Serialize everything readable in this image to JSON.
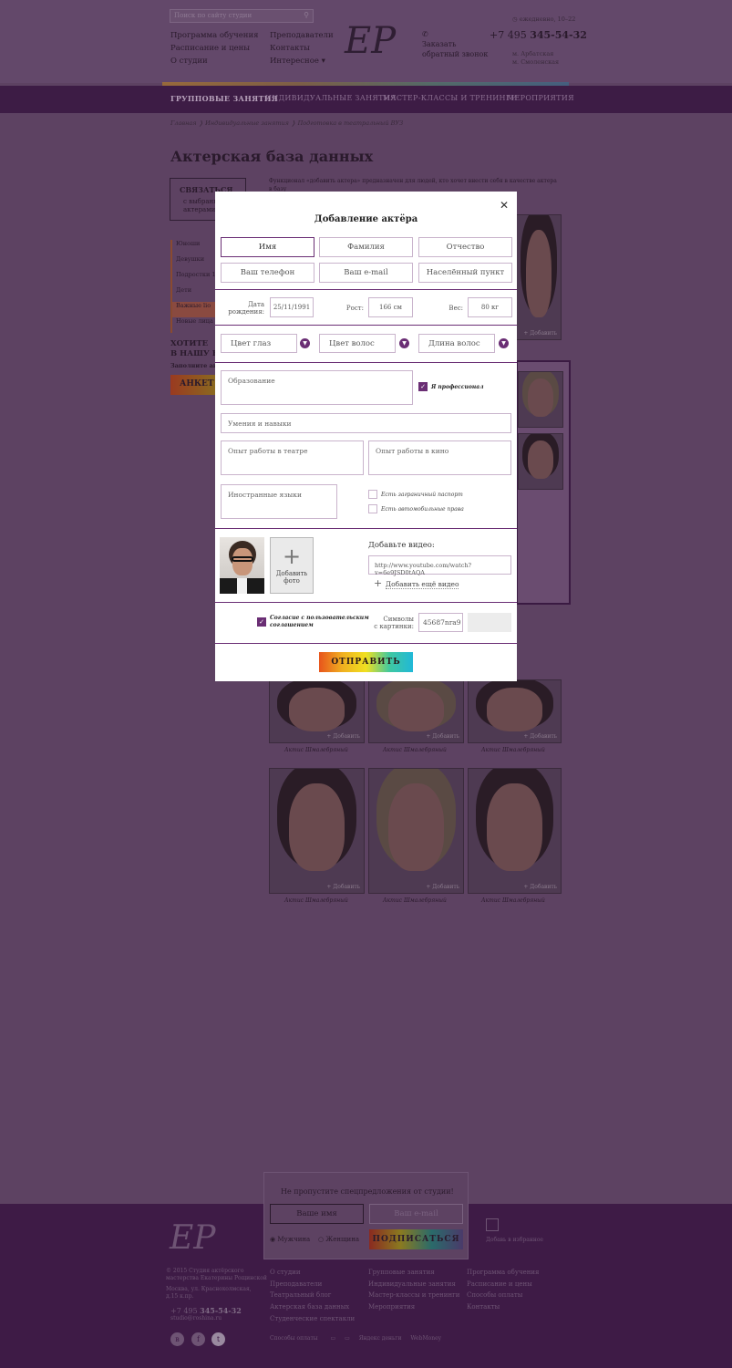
{
  "header": {
    "search_placeholder": "Поиск по сайту студии",
    "links_col1": [
      "Программа обучения",
      "Расписание и цены",
      "О студии"
    ],
    "links_col2": [
      "Преподаватели",
      "Контакты",
      "Интересное"
    ],
    "logo": "EP",
    "callback": [
      "Заказать",
      "обратный звонок"
    ],
    "worktime": "ежедневно, 10–22",
    "phone_prefix": "+7 495",
    "phone_number": "345-54-32",
    "metro": [
      "м. Арбатская",
      "м. Смоленская"
    ]
  },
  "nav": [
    "ГРУППОВЫЕ ЗАНЯТИЯ",
    "ИНДИВИДУАЛЬНЫЕ ЗАНЯТИЯ",
    "МАСТЕР-КЛАССЫ И ТРЕНИНГИ",
    "МЕРОПРИЯТИЯ"
  ],
  "breadcrumb": [
    "Главная",
    "Индивидуальные занятия",
    "Подготовка в театральный ВУЗ"
  ],
  "page_title": "Актерская база данных",
  "contact_box": {
    "title": "СВЯЗАТЬСЯ",
    "sub": [
      "с выбранными",
      "актерами"
    ]
  },
  "intro_text": "Функционал «добавить актера» предназначен для людей, кто хочет внести себя в качестве актера в базу",
  "filters": [
    "Юноши",
    "Девушки",
    "Подростки 15+",
    "Дети",
    "Важные lio",
    "Новые лица"
  ],
  "want": [
    "ХОТИТЕ",
    "В НАШУ Б"
  ],
  "want_sub": "Заполните анкет",
  "anket_btn": "АНКЕТ",
  "tile_add": "+ Добавить",
  "tile_caption": "Актис Шмалебряный",
  "modal": {
    "title": "Добавление актёра",
    "first_name": "Имя",
    "last_name": "Фамилия",
    "patronymic": "Отчество",
    "phone": "Ваш телефон",
    "email": "Ваш e-mail",
    "city": "Населённый пункт",
    "birth_label": [
      "Дата",
      "рождения:"
    ],
    "birth_value": "25/11/1991",
    "height_label": "Рост:",
    "height_value": "166 см",
    "weight_label": "Вес:",
    "weight_value": "80 кг",
    "eye_color": "Цвет глаз",
    "hair_color": "Цвет волос",
    "hair_length": "Длина волос",
    "education": "Образование",
    "professional": "Я профессионал",
    "skills": "Умения и навыки",
    "theatre_exp": "Опыт работы в театре",
    "cinema_exp": "Опыт работы в кино",
    "languages": "Иностранные языки",
    "passport": "Есть заграничный паспорт",
    "license": "Есть автомобильные права",
    "add_photo": [
      "Добавить",
      "фото"
    ],
    "video_title": "Добавьте видео:",
    "video_url": "http://www.youtube.com/watch?v=6e9JSD0tAQA",
    "add_video": "Добавить ещё видео",
    "agree": [
      "Согласие с пользовательским",
      "соглашением"
    ],
    "captcha_label": [
      "Символы",
      "с картинки:"
    ],
    "captcha_value": "45687nra9",
    "submit": "ОТПРАВИТЬ"
  },
  "subscribe": {
    "title": "Не пропустите спецпредложения от студии!",
    "name": "Ваше имя",
    "email": "Ваш e-mail",
    "male": "Мужчина",
    "female": "Женщина",
    "button": "ПОДПИСАТЬСЯ"
  },
  "footer": {
    "copyright": [
      "© 2015 Студия актёрского",
      "мастерства Екатерины Рощинской"
    ],
    "address": [
      "Москва, ул. Краснохолмская,",
      "д.15 к.пр."
    ],
    "phone_prefix": "+7 495",
    "phone_number": "345-54-32",
    "email": "studio@roshina.ru",
    "col1": [
      "О студии",
      "Преподаватели",
      "Театральный блог",
      "Актерская база данных",
      "Студенческие спектакли"
    ],
    "col2": [
      "Групповые занятия",
      "Мастер-классы и тренинги",
      "Мероприятия"
    ],
    "col2b": "Индивидуальные занятия",
    "col3": [
      "Программа обучения",
      "Расписание и цены",
      "Способы оплаты",
      "Контакты"
    ],
    "payments": "Способы оплаты",
    "favorite": "Добавь в избранное",
    "pay_yandex": "Яндекс деньги",
    "pay_webmoney": "WebMoney"
  }
}
